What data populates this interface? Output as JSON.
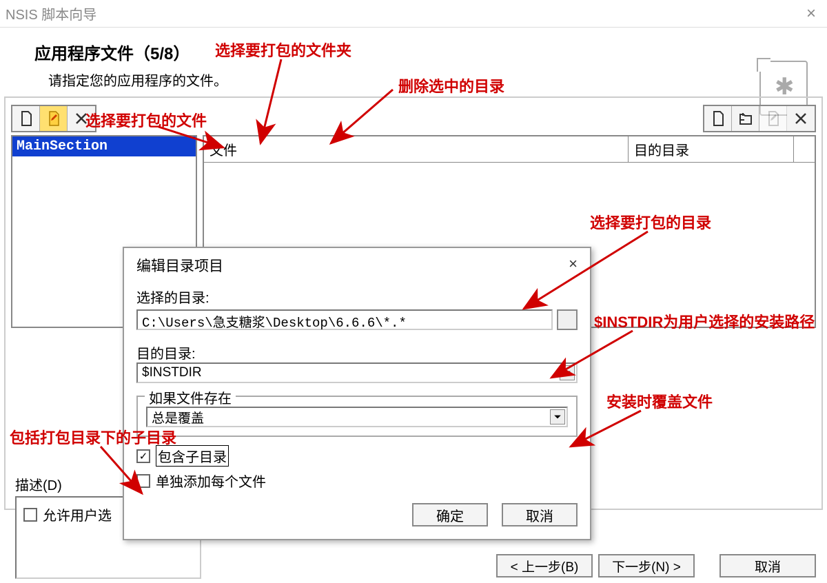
{
  "window": {
    "title": "NSIS 脚本向导",
    "close_glyph": "×"
  },
  "header": {
    "title": "应用程序文件（5/8）",
    "subtitle": "请指定您的应用程序的文件。"
  },
  "toolbar_left": {
    "new_icon": "new-file",
    "edit_icon": "edit-file",
    "delete_icon": "delete"
  },
  "toolbar_right": {
    "add_file": "add-file",
    "add_folder": "add-folder",
    "edit": "edit",
    "delete": "delete"
  },
  "sections": {
    "item0": "MainSection"
  },
  "file_table": {
    "col_file": "文件",
    "col_dest": "目的目录"
  },
  "description_label": "描述(D)",
  "allow_user_select": "允许用户选",
  "wizard_buttons": {
    "back": "< 上一步(B)",
    "next": "下一步(N) >",
    "cancel": "取消"
  },
  "dialog": {
    "title": "编辑目录项目",
    "close_glyph": "×",
    "src_label": "选择的目录:",
    "src_value": "C:\\Users\\急支糖浆\\Desktop\\6.6.6\\*.*",
    "dest_label": "目的目录:",
    "dest_value": "$INSTDIR",
    "if_exists_legend": "如果文件存在",
    "overwrite_value": "总是覆盖",
    "include_sub_label": "包含子目录",
    "add_each_label": "单独添加每个文件",
    "ok": "确定",
    "cancel": "取消",
    "include_sub_checked": "✓"
  },
  "annotations": {
    "select_files": "选择要打包的文件",
    "select_folder": "选择要打包的文件夹",
    "delete_selected": "删除选中的目录",
    "select_package_dir": "选择要打包的目录",
    "instdir_hint": "$INSTDIR为用户选择的安装路径",
    "overwrite_hint": "安装时覆盖文件",
    "subdir_hint": "包括打包目录下的子目录"
  }
}
